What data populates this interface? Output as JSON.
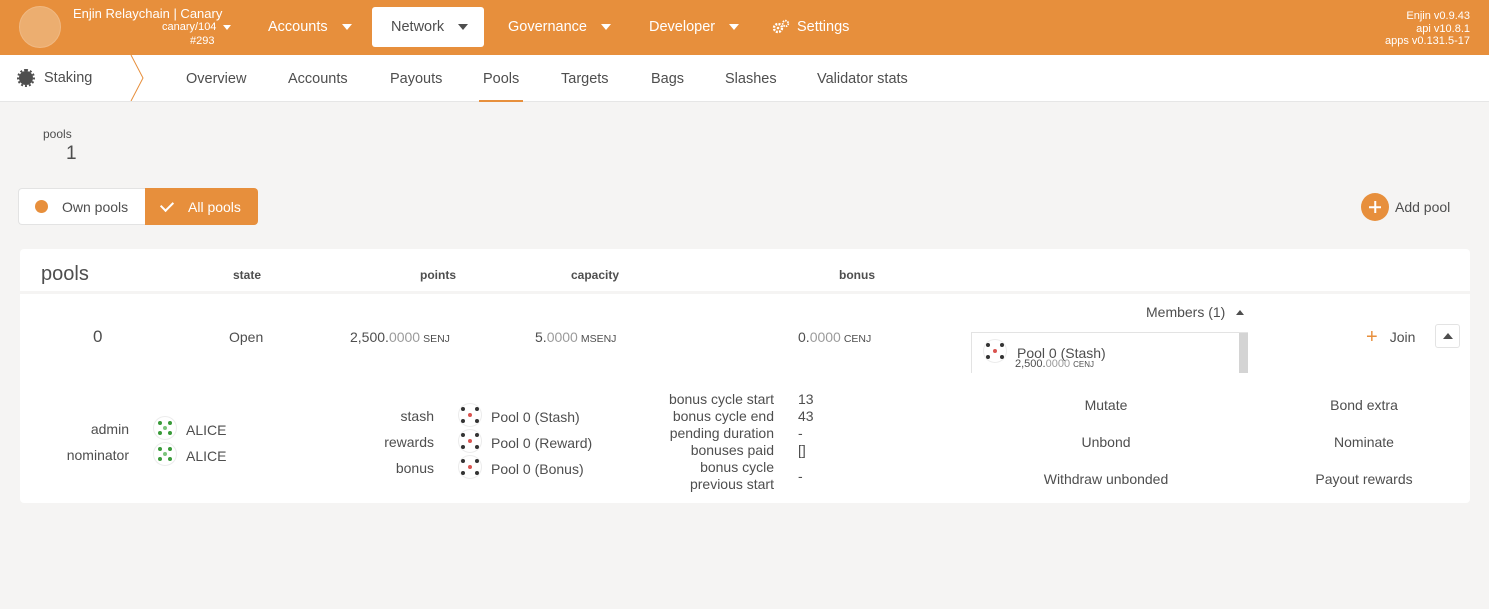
{
  "topbar": {
    "chain_name": "Enjin Relaychain | Canary",
    "chain_spec": "canary/104",
    "block": "#293",
    "menu": [
      "Accounts",
      "Network",
      "Governance",
      "Developer",
      "Settings"
    ],
    "versions": [
      "Enjin v0.9.43",
      "api v10.8.1",
      "apps v0.131.5-17"
    ],
    "accent": "#e78f3c"
  },
  "subnav": {
    "section": "Staking",
    "tabs": [
      "Overview",
      "Accounts",
      "Payouts",
      "Pools",
      "Targets",
      "Bags",
      "Slashes",
      "Validator stats"
    ],
    "active_tab": "Pools"
  },
  "summary": {
    "label": "pools",
    "value": "1"
  },
  "toggle": {
    "own": "Own pools",
    "all": "All pools",
    "selected": "All pools"
  },
  "add_pool": "Add pool",
  "table": {
    "title": "pools",
    "headers": {
      "state": "state",
      "points": "points",
      "capacity": "capacity",
      "bonus": "bonus"
    }
  },
  "pool": {
    "id": "0",
    "state": "Open",
    "points_int": "2,500.",
    "points_dec": "0000",
    "points_unit": "SENJ",
    "capacity_int": "5.",
    "capacity_dec": "0000",
    "capacity_unit": "MSENJ",
    "bonus_int": "0.",
    "bonus_dec": "0000",
    "bonus_unit": "CENJ",
    "members_label": "Members (1)",
    "member_name": "Pool 0 (Stash)",
    "member_bal_int": "2,500.",
    "member_bal_dec": "0000",
    "member_bal_unit": "CENJ",
    "join": "Join",
    "roles": {
      "admin_label": "admin",
      "admin": "ALICE",
      "nominator_label": "nominator",
      "nominator": "ALICE"
    },
    "accounts": {
      "stash_label": "stash",
      "stash": "Pool 0 (Stash)",
      "rewards_label": "rewards",
      "rewards": "Pool 0 (Reward)",
      "bonus_label": "bonus",
      "bonus": "Pool 0 (Bonus)"
    },
    "bonus_info": {
      "cycle_start_label": "bonus cycle start",
      "cycle_start": "13",
      "cycle_end_label": "bonus cycle end",
      "cycle_end": "43",
      "pending_label": "pending duration",
      "pending": "-",
      "paid_label": "bonuses paid",
      "paid": "[]",
      "prev_label_1": "bonus cycle",
      "prev_label_2": "previous start",
      "prev": "-"
    },
    "actions": [
      "Mutate",
      "Bond extra",
      "Unbond",
      "Nominate",
      "Withdraw unbonded",
      "Payout rewards"
    ]
  }
}
